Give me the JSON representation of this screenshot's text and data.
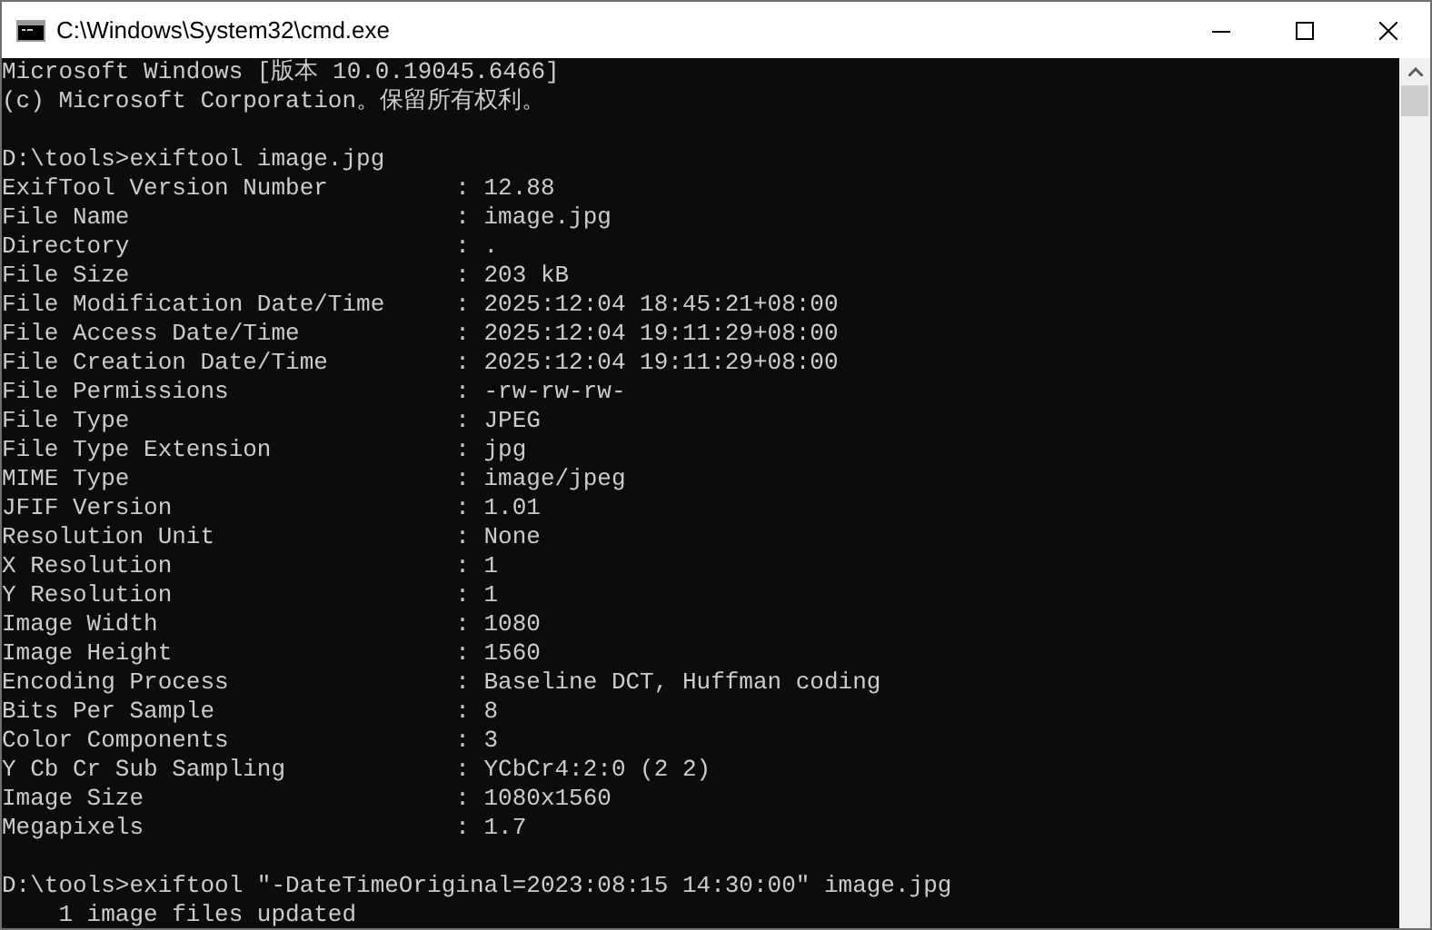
{
  "window": {
    "title": "C:\\Windows\\System32\\cmd.exe"
  },
  "console": {
    "blocks": [
      {
        "lines": [
          "Microsoft Windows [版本 10.0.19045.6466]",
          "(c) Microsoft Corporation。保留所有权利。"
        ]
      },
      {
        "lines": [
          "D:\\tools>exiftool image.jpg",
          "ExifTool Version Number         : 12.88",
          "File Name                       : image.jpg",
          "Directory                       : .",
          "File Size                       : 203 kB",
          "File Modification Date/Time     : 2025:12:04 18:45:21+08:00",
          "File Access Date/Time           : 2025:12:04 19:11:29+08:00",
          "File Creation Date/Time         : 2025:12:04 19:11:29+08:00",
          "File Permissions                : -rw-rw-rw-",
          "File Type                       : JPEG",
          "File Type Extension             : jpg",
          "MIME Type                       : image/jpeg",
          "JFIF Version                    : 1.01",
          "Resolution Unit                 : None",
          "X Resolution                    : 1",
          "Y Resolution                    : 1",
          "Image Width                     : 1080",
          "Image Height                    : 1560",
          "Encoding Process                : Baseline DCT, Huffman coding",
          "Bits Per Sample                 : 8",
          "Color Components                : 3",
          "Y Cb Cr Sub Sampling            : YCbCr4:2:0 (2 2)",
          "Image Size                      : 1080x1560",
          "Megapixels                      : 1.7"
        ]
      },
      {
        "lines": [
          "D:\\tools>exiftool \"-DateTimeOriginal=2023:08:15 14:30:00\" image.jpg",
          "    1 image files updated"
        ]
      }
    ]
  }
}
